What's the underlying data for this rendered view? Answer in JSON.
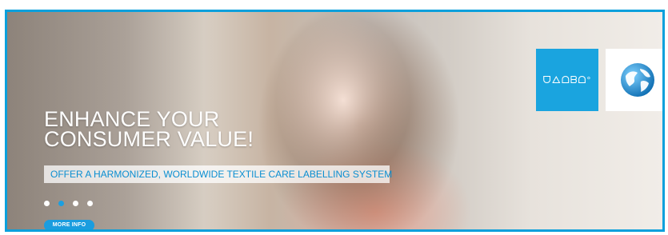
{
  "hero": {
    "headline_line1": "ENHANCE YOUR",
    "headline_line2": "CONSUMER VALUE!",
    "subheadline": "OFFER A HARMONIZED, WORLDWIDE TEXTILE CARE LABELLING SYSTEM",
    "button_label": "MORE INFO",
    "slides": [
      {
        "active": false
      },
      {
        "active": true
      },
      {
        "active": false
      },
      {
        "active": false
      }
    ]
  },
  "badges": {
    "logo_text": "ᗜᐃᗝᗷᗝ°",
    "globe_icon": "globe-icon"
  },
  "colors": {
    "accent": "#1a9ddf",
    "frame": "#0aa0dc"
  }
}
